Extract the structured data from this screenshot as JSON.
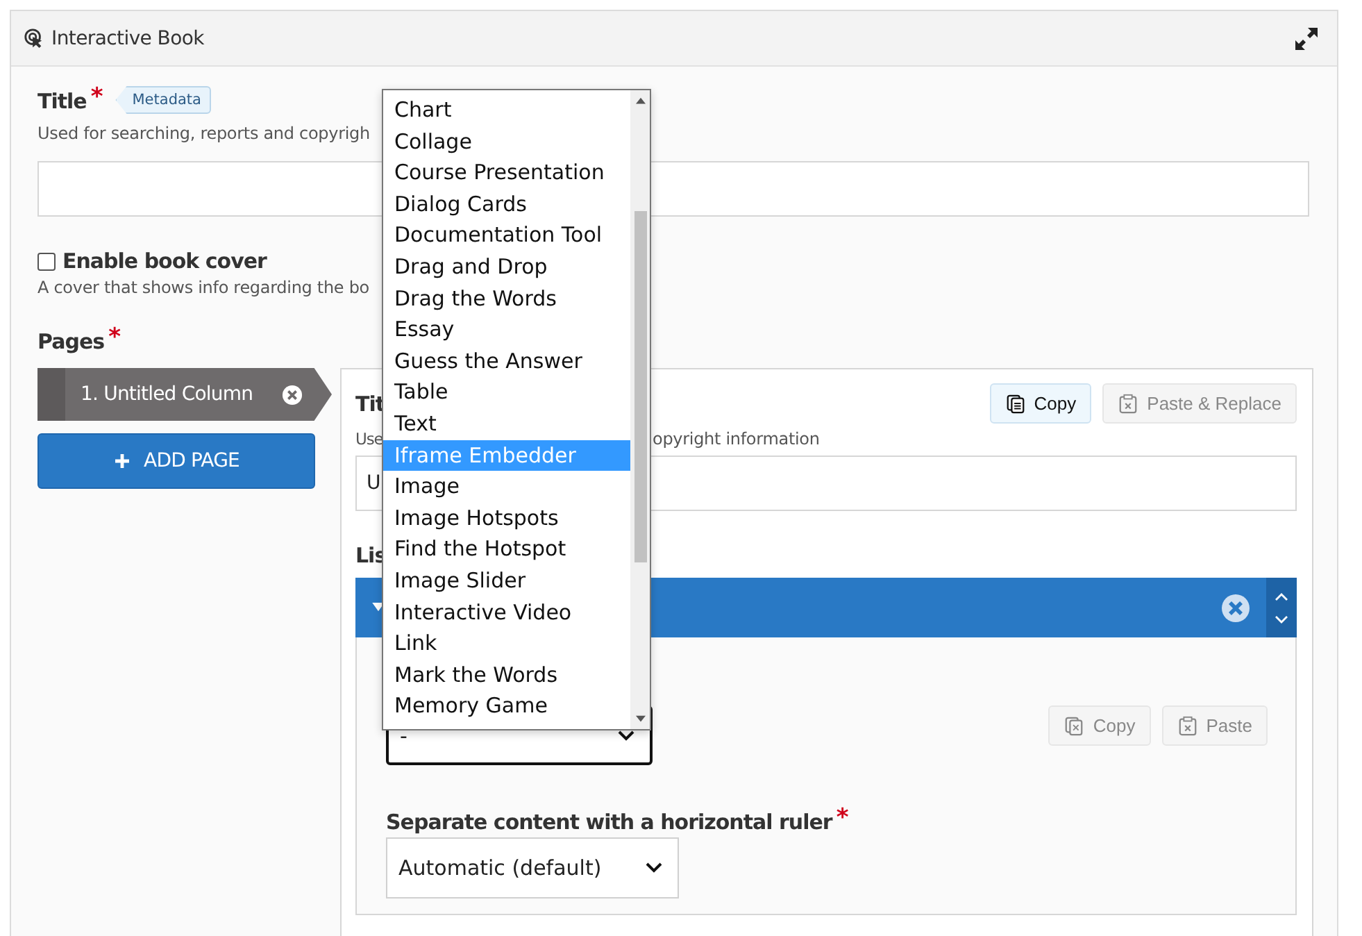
{
  "window": {
    "title": "Interactive Book"
  },
  "title_field": {
    "label": "Title",
    "required_mark": "*",
    "tag": "Metadata",
    "description": "Used for searching, reports and copyrigh"
  },
  "book_cover": {
    "label": "Enable book cover",
    "checked": false,
    "description": "A cover that shows info regarding the bo"
  },
  "pages": {
    "label": "Pages",
    "required_mark": "*",
    "items": [
      {
        "label": "1. Untitled Column",
        "selected": true
      }
    ],
    "add_button": "ADD PAGE"
  },
  "page_editor": {
    "label": "Tit",
    "copy_button": {
      "label": "Copy",
      "disabled": false
    },
    "paste_button": {
      "label": "Paste & Replace",
      "disabled": true
    },
    "description_start": "Use",
    "description_end": "opyright information",
    "value": "U",
    "list_label": "Lis"
  },
  "content_item": {
    "expanded": true,
    "type_select": {
      "value": "-",
      "options": [
        {
          "label": "Chart",
          "selected": false
        },
        {
          "label": "Collage",
          "selected": false
        },
        {
          "label": "Course Presentation",
          "selected": false
        },
        {
          "label": "Dialog Cards",
          "selected": false
        },
        {
          "label": "Documentation Tool",
          "selected": false
        },
        {
          "label": "Drag and Drop",
          "selected": false
        },
        {
          "label": "Drag the Words",
          "selected": false
        },
        {
          "label": "Essay",
          "selected": false
        },
        {
          "label": "Guess the Answer",
          "selected": false
        },
        {
          "label": "Table",
          "selected": false
        },
        {
          "label": "Text",
          "selected": false
        },
        {
          "label": "Iframe Embedder",
          "selected": true
        },
        {
          "label": "Image",
          "selected": false
        },
        {
          "label": "Image Hotspots",
          "selected": false
        },
        {
          "label": "Find the Hotspot",
          "selected": false
        },
        {
          "label": "Image Slider",
          "selected": false
        },
        {
          "label": "Interactive Video",
          "selected": false
        },
        {
          "label": "Link",
          "selected": false
        },
        {
          "label": "Mark the Words",
          "selected": false
        },
        {
          "label": "Memory Game",
          "selected": false
        }
      ]
    },
    "copy_button": {
      "label": "Copy",
      "disabled": true
    },
    "paste_button": {
      "label": "Paste",
      "disabled": true
    },
    "ruler": {
      "label": "Separate content with a horizontal ruler",
      "required_mark": "*",
      "value": "Automatic (default)"
    }
  }
}
